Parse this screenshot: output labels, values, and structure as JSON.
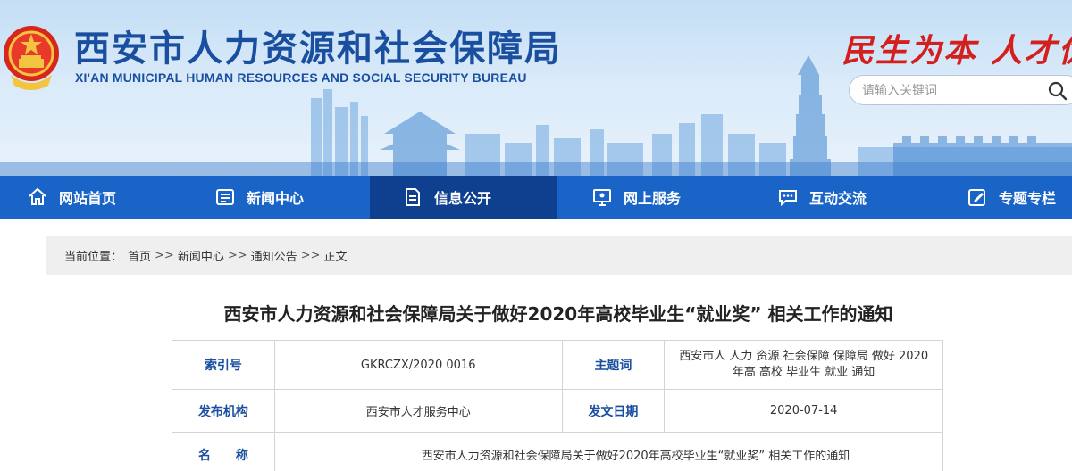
{
  "header": {
    "title_cn": "西安市人力资源和社会保障局",
    "title_en": "XI'AN MUNICIPAL HUMAN RESOURCES AND SOCIAL SECURITY BUREAU",
    "slogan": "民生为本 人才优先",
    "emblem_icon": "national-emblem-icon"
  },
  "search": {
    "placeholder": "请输入关键词",
    "icon": "search-icon"
  },
  "nav": {
    "items": [
      {
        "label": "网站首页",
        "icon": "home-icon"
      },
      {
        "label": "新闻中心",
        "icon": "news-icon"
      },
      {
        "label": "信息公开",
        "icon": "document-icon",
        "active": true
      },
      {
        "label": "网上服务",
        "icon": "monitor-icon"
      },
      {
        "label": "互动交流",
        "icon": "chat-icon"
      },
      {
        "label": "专题专栏",
        "icon": "edit-icon"
      }
    ],
    "color": "#1a64c8",
    "active_color": "#0f3f8f"
  },
  "breadcrumb": {
    "prefix": "当前位置：",
    "items": [
      "首页",
      "新闻中心",
      "通知公告",
      "正文"
    ],
    "separator": ">>"
  },
  "article": {
    "title": "西安市人力资源和社会保障局关于做好2020年高校毕业生“就业奖” 相关工作的通知"
  },
  "info": {
    "index_label": "索引号",
    "index_value": "GKRCZX/2020 0016",
    "subject_label": "主题词",
    "subject_value": "西安市人 人力 资源 社会保障 保障局 做好 2020 年高 高校 毕业生 就业 通知",
    "publisher_label": "发布机构",
    "publisher_value": "西安市人才服务中心",
    "date_label": "发文日期",
    "date_value": "2020-07-14",
    "name_label": "名　　称",
    "name_value": "西安市人力资源和社会保障局关于做好2020年高校毕业生“就业奖” 相关工作的通知"
  }
}
